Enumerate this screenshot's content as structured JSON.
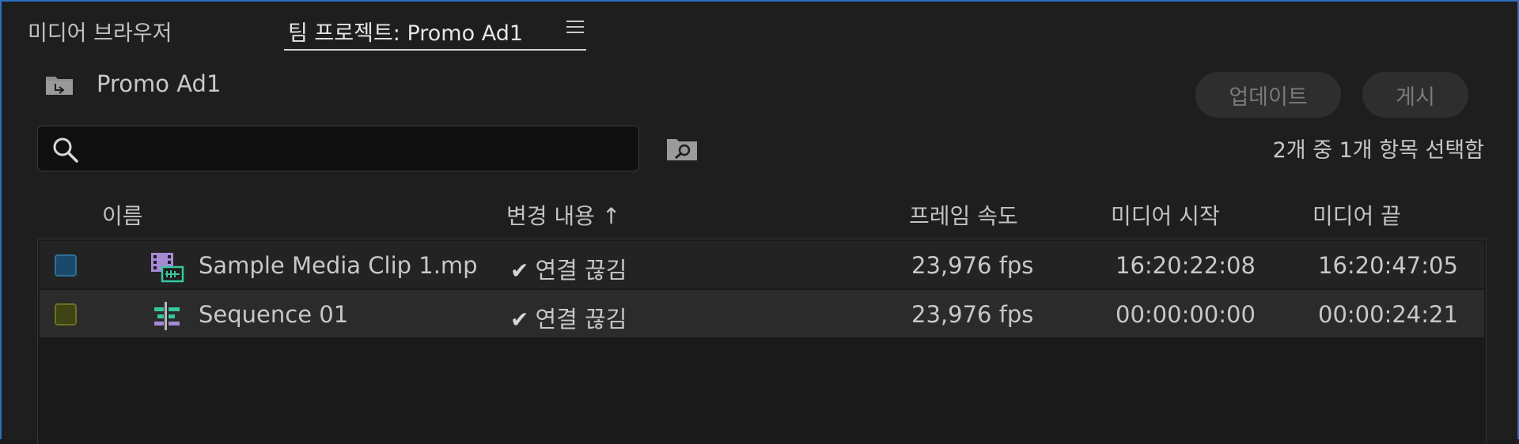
{
  "tabs": [
    {
      "label": "미디어 브라우저",
      "active": false
    },
    {
      "label": "팀 프로젝트: Promo Ad1",
      "active": true
    }
  ],
  "project": {
    "title": "Promo Ad1"
  },
  "buttons": {
    "update": "업데이트",
    "publish": "게시"
  },
  "search": {
    "value": "",
    "placeholder": ""
  },
  "selection_status": "2개 중 1개 항목 선택함",
  "columns": {
    "name": "이름",
    "change": "변경 내용 ↑",
    "frame_rate": "프레임 속도",
    "media_start": "미디어 시작",
    "media_end": "미디어 끝"
  },
  "rows": [
    {
      "label_color": "#1a4a6b",
      "label_border": "#2f6f96",
      "icon": "film-clip-icon",
      "name": "Sample Media Clip 1.mp",
      "change": "연결 끊김",
      "frame_rate": "23,976 fps",
      "media_start": "16:20:22:08",
      "media_end": "16:20:47:05"
    },
    {
      "label_color": "#3f4414",
      "label_border": "#6b7024",
      "icon": "sequence-icon",
      "name": "Sequence 01",
      "change": "연결 끊김",
      "frame_rate": "23,976 fps",
      "media_start": "00:00:00:00",
      "media_end": "00:00:24:21"
    }
  ],
  "colors": {
    "accent_border": "#2d6ec2",
    "background": "#1e1e1e"
  }
}
